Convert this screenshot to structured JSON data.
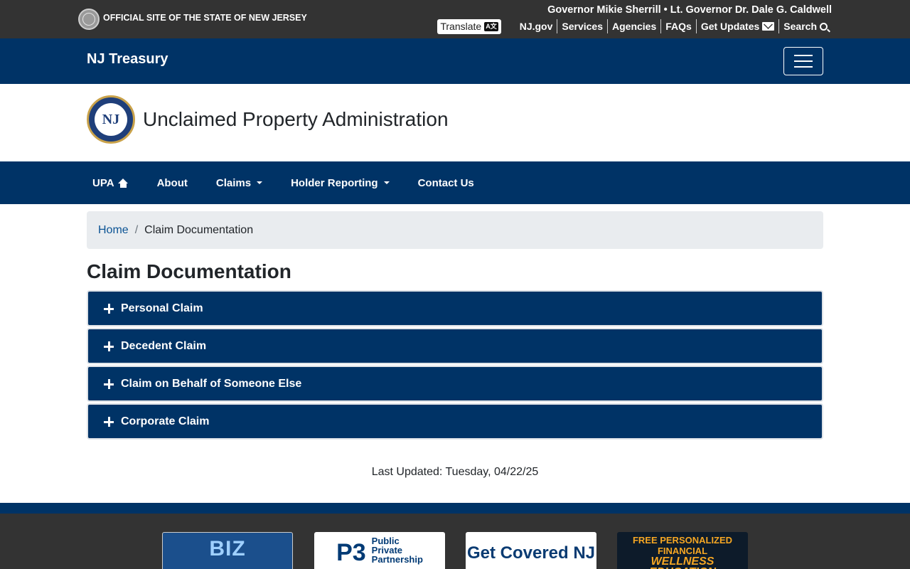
{
  "state_bar": {
    "official_text": "OFFICIAL SITE OF THE STATE OF NEW JERSEY",
    "governor_text": "Governor Mikie Sherrill • Lt. Governor Dr. Dale G. Caldwell",
    "translate_label": "Translate",
    "translate_icon_text": "A文",
    "links": [
      "NJ.gov",
      "Services",
      "Agencies",
      "FAQs",
      "Get Updates",
      "Search"
    ]
  },
  "treasury_bar": {
    "title": "NJ Treasury"
  },
  "agency": {
    "logo_text": "NJ",
    "title": "Unclaimed Property Administration"
  },
  "nav": {
    "items": [
      "UPA",
      "About",
      "Claims",
      "Holder Reporting",
      "Contact Us"
    ]
  },
  "breadcrumb": {
    "home": "Home",
    "separator": "/",
    "current": "Claim Documentation"
  },
  "page": {
    "title": "Claim Documentation",
    "last_updated": "Last Updated: Tuesday, 04/22/25"
  },
  "accordion": {
    "items": [
      "Personal Claim",
      "Decedent Claim",
      "Claim on Behalf of Someone Else",
      "Corporate Claim"
    ]
  },
  "footer": {
    "promos": {
      "biz": "BIZ",
      "p3_big": "P3",
      "p3_lines": [
        "Public",
        "Private",
        "Partnership"
      ],
      "covered": "Get Covered NJ",
      "fin_top": "FREE PERSONALIZED FINANCIAL",
      "fin_sub": "WELLNESS EDUCATION"
    }
  },
  "colors": {
    "navy": "#003366",
    "dark_gray": "#333333",
    "breadcrumb_bg": "#e9ecef",
    "link_blue": "#0b5394"
  }
}
